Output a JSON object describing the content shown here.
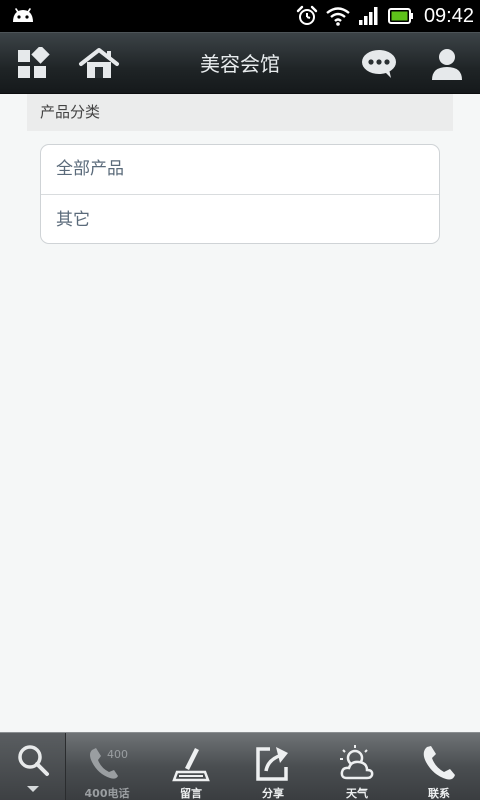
{
  "status_bar": {
    "time": "09:42"
  },
  "title_bar": {
    "title": "美容会馆"
  },
  "section": {
    "title": "产品分类"
  },
  "categories": [
    {
      "label": "全部产品"
    },
    {
      "label": "其它"
    }
  ],
  "bottom_bar": {
    "items": [
      {
        "label": "400电话",
        "badge": "400"
      },
      {
        "label": "留言"
      },
      {
        "label": "分享"
      },
      {
        "label": "天气"
      },
      {
        "label": "联系"
      }
    ]
  },
  "colors": {
    "title_bar": "#1f2426",
    "background": "#f5f7f7",
    "battery": "#5ec21a"
  }
}
